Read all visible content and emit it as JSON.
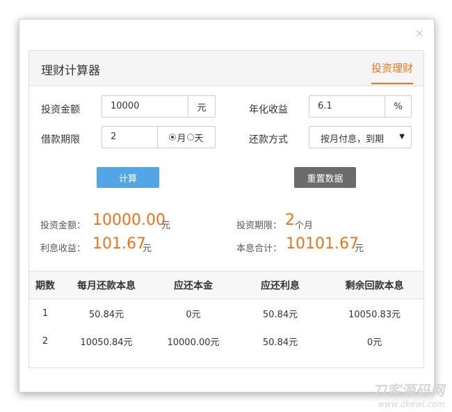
{
  "dialog": {
    "close_icon": "×"
  },
  "panel": {
    "title": "理财计算器",
    "tab": "投资理财"
  },
  "form": {
    "amount_label": "投资金额",
    "amount_value": "10000",
    "amount_unit": "元",
    "rate_label": "年化收益",
    "rate_value": "6.1",
    "rate_unit": "%",
    "period_label": "借款期限",
    "period_value": "2",
    "period_options": [
      {
        "label": "月",
        "selected": true
      },
      {
        "label": "天",
        "selected": false
      }
    ],
    "repay_label": "还款方式",
    "repay_value": "按月付息，到期",
    "calc_button": "计算",
    "reset_button": "重置数据"
  },
  "result": {
    "amount_label": "投资金额：",
    "amount_value": "10000.00",
    "amount_unit": "元",
    "period_label": "投资期限：",
    "period_value": "2",
    "period_unit": "个月",
    "interest_label": "利息收益：",
    "interest_value": "101.67",
    "interest_unit": "元",
    "total_label": "本息合计：",
    "total_value": "10101.67",
    "total_unit": "元"
  },
  "table": {
    "headers": [
      "期数",
      "每月还款本息",
      "应还本金",
      "应还利息",
      "剩余回款本息"
    ],
    "rows": [
      [
        "1",
        "50.84元",
        "0元",
        "50.84元",
        "10050.83元"
      ],
      [
        "2",
        "10050.84元",
        "10000.00元",
        "50.84元",
        "0元"
      ]
    ]
  },
  "colors": {
    "accent": "#e8741e",
    "calc_button": "#53a6e6",
    "reset_button": "#6b6b6b"
  },
  "watermark": {
    "line1": "刀客源码网",
    "line2": "www.dkewl.com"
  }
}
